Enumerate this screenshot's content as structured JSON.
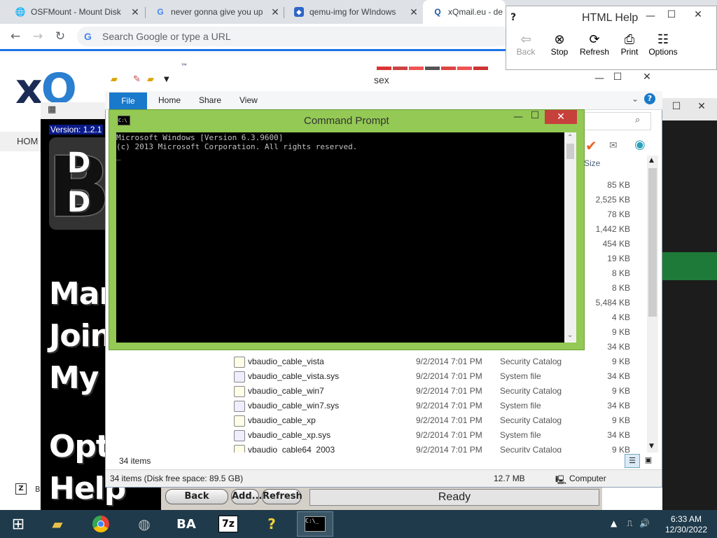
{
  "browser": {
    "tabs": [
      {
        "title": "OSFMount - Mount Disk",
        "icon": "globe-icon"
      },
      {
        "title": "never gonna give you up",
        "icon": "google-icon"
      },
      {
        "title": "qemu-img for WIndows",
        "icon": "site-icon"
      },
      {
        "title": "xQmail.eu - de s",
        "icon": "site-icon"
      }
    ],
    "omnibox_placeholder": "Search Google or type a URL",
    "page": {
      "logo_prefix": "x",
      "logo_rest": "Q",
      "logo_tm": "™",
      "nav_home": "HOM",
      "footer_label": "B"
    }
  },
  "html_help": {
    "title": "HTML Help",
    "buttons": [
      "Back",
      "Stop",
      "Refresh",
      "Print",
      "Options"
    ]
  },
  "band": {
    "version": "Version: 1.2.1",
    "big_letters": "B",
    "big_letters2": "D",
    "big_letters3": "D",
    "lines": [
      "Mar",
      "Join",
      "My /",
      "Opti",
      "Help"
    ],
    "back": "Back",
    "add": "Add...",
    "refresh": "Refresh",
    "status": "Ready"
  },
  "explorer": {
    "title": "sex",
    "ribbon": {
      "file": "File",
      "home": "Home",
      "share": "Share",
      "view": "View"
    },
    "size_header": "Size",
    "hidden_sizes": [
      "85 KB",
      "2,525 KB",
      "78 KB",
      "1,442 KB",
      "454 KB",
      "19 KB",
      "8 KB",
      "8 KB",
      "5,484 KB",
      "4 KB",
      "9 KB",
      "34 KB"
    ],
    "rows": [
      {
        "name": "vbaudio_cable_vista",
        "date": "9/2/2014 7:01 PM",
        "type": "Security Catalog",
        "size": "9 KB"
      },
      {
        "name": "vbaudio_cable_vista.sys",
        "date": "9/2/2014 7:01 PM",
        "type": "System file",
        "size": "34 KB"
      },
      {
        "name": "vbaudio_cable_win7",
        "date": "9/2/2014 7:01 PM",
        "type": "Security Catalog",
        "size": "9 KB"
      },
      {
        "name": "vbaudio_cable_win7.sys",
        "date": "9/2/2014 7:01 PM",
        "type": "System file",
        "size": "34 KB"
      },
      {
        "name": "vbaudio_cable_xp",
        "date": "9/2/2014 7:01 PM",
        "type": "Security Catalog",
        "size": "9 KB"
      },
      {
        "name": "vbaudio_cable_xp.sys",
        "date": "9/2/2014 7:01 PM",
        "type": "System file",
        "size": "34 KB"
      },
      {
        "name": "vbaudio_cable64_2003",
        "date": "9/2/2014 7:01 PM",
        "type": "Security Catalog",
        "size": "9 KB"
      }
    ],
    "item_count": "34 items",
    "status_left": "34 items (Disk free space: 89.5 GB)",
    "status_size": "12.7 MB",
    "status_location": "Computer"
  },
  "cmd": {
    "title": "Command Prompt",
    "line1": "Microsoft Windows [Version 6.3.9600]",
    "line2": "(c) 2013 Microsoft Corporation. All rights reserved.",
    "cursor": "_"
  },
  "taskbar": {
    "time": "6:33 AM",
    "date": "12/30/2022"
  },
  "colors": {
    "chrome_blue": "#1a73e8",
    "cmd_green": "#93c954",
    "ribbon_file_blue": "#1979ca",
    "taskbar": "#1f3a4a"
  }
}
